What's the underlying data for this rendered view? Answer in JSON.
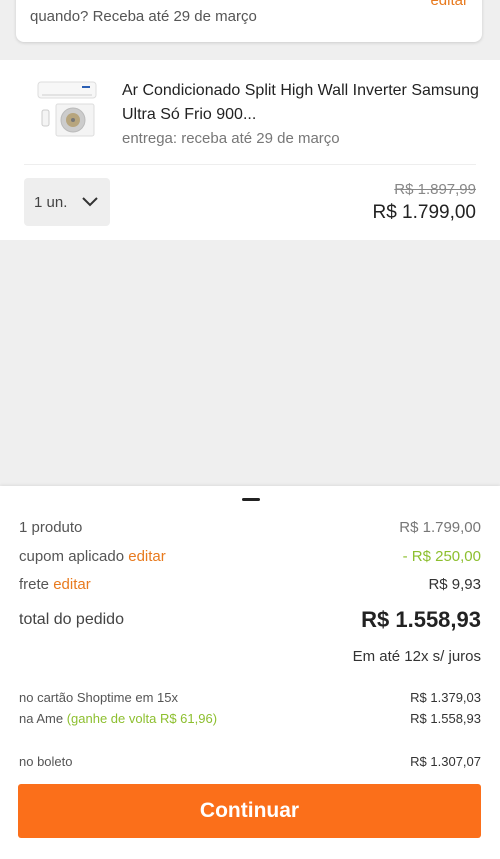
{
  "delivery": {
    "text": "quando? Receba até 29 de março",
    "edit_label": "editar"
  },
  "product": {
    "title": "Ar Condicionado Split High Wall Inverter Samsung Ultra Só Frio 900...",
    "delivery": "entrega: receba até 29 de março",
    "quantity": "1 un.",
    "price_old": "R$ 1.897,99",
    "price_new": "R$ 1.799,00",
    "image_icon": "air-conditioner-icon"
  },
  "summary": {
    "products_label": "1 produto",
    "products_value": "R$ 1.799,00",
    "coupon_label": "cupom aplicado",
    "coupon_edit": "editar",
    "coupon_value": "- R$ 250,00",
    "shipping_label": "frete",
    "shipping_edit": "editar",
    "shipping_value": "R$ 9,93",
    "total_label": "total do pedido",
    "total_value": "R$ 1.558,93",
    "installments": "Em até 12x s/ juros",
    "card_label": "no cartão Shoptime em 15x",
    "card_value": "R$ 1.379,03",
    "ame_label": "na Ame",
    "ame_cashback": "(ganhe de volta R$ 61,96)",
    "ame_value": "R$ 1.558,93",
    "boleto_label": "no boleto",
    "boleto_value": "R$ 1.307,07",
    "continue_label": "Continuar"
  },
  "colors": {
    "accent": "#fb6f1a",
    "link": "#e87a1e",
    "discount": "#8dbf2f"
  }
}
